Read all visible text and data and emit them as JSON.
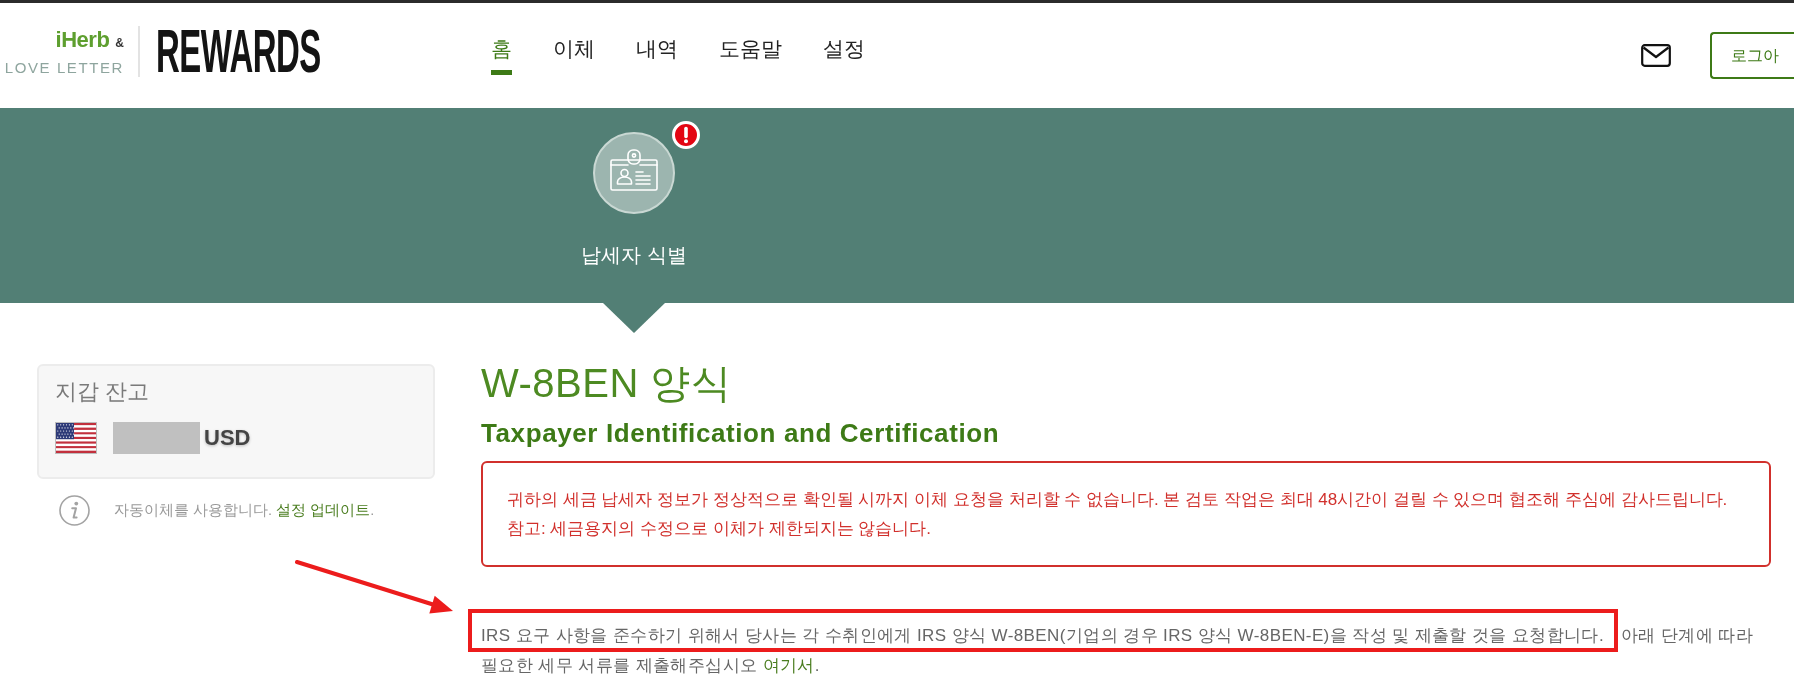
{
  "header": {
    "logo": {
      "brand": "iHerb",
      "ampersand": "&",
      "partner": "LOVE LETTER",
      "program": "REWARDS"
    },
    "nav": [
      {
        "label": "홈",
        "selected": true
      },
      {
        "label": "이체",
        "selected": false
      },
      {
        "label": "내역",
        "selected": false
      },
      {
        "label": "도움말",
        "selected": false
      },
      {
        "label": "설정",
        "selected": false
      }
    ],
    "logout_button": "로그아"
  },
  "steps": [
    {
      "label": "납세자 식별",
      "alert": true,
      "selected": true
    }
  ],
  "wallet": {
    "title": "지갑 잔고",
    "currency": "USD"
  },
  "auto_transfer": {
    "text": "자동이체를 사용합니다.",
    "link": "설정 업데이트",
    "end": "."
  },
  "form": {
    "title": "W-8BEN 양식",
    "subtitle": "Taxpayer Identification and Certification",
    "alert": "귀하의 세금 납세자 정보가 정상적으로 확인될 시까지 이체 요청을 처리할 수 없습니다. 본 검토 작업은 최대 48시간이 걸릴 수 있으며 협조해 주심에 감사드립니다. 참고: 세금용지의 수정으로 이체가 제한되지는 않습니다.",
    "paragraph": {
      "highlighted_text": "IRS 요구 사항을 준수하기 위해서 당사는 각 수취인에게 IRS 양식 W-8BEN(기업의 경우 IRS 양식 W-8BEN-E)을 작성 및 제출할 것을 요청합니다.",
      "highlighted": true,
      "arrow": true,
      "continuation": "아래 단계에 따라",
      "text": "필요한 세무 서류를 제출해주십시오",
      "link": "여기서",
      "end": "."
    }
  }
}
